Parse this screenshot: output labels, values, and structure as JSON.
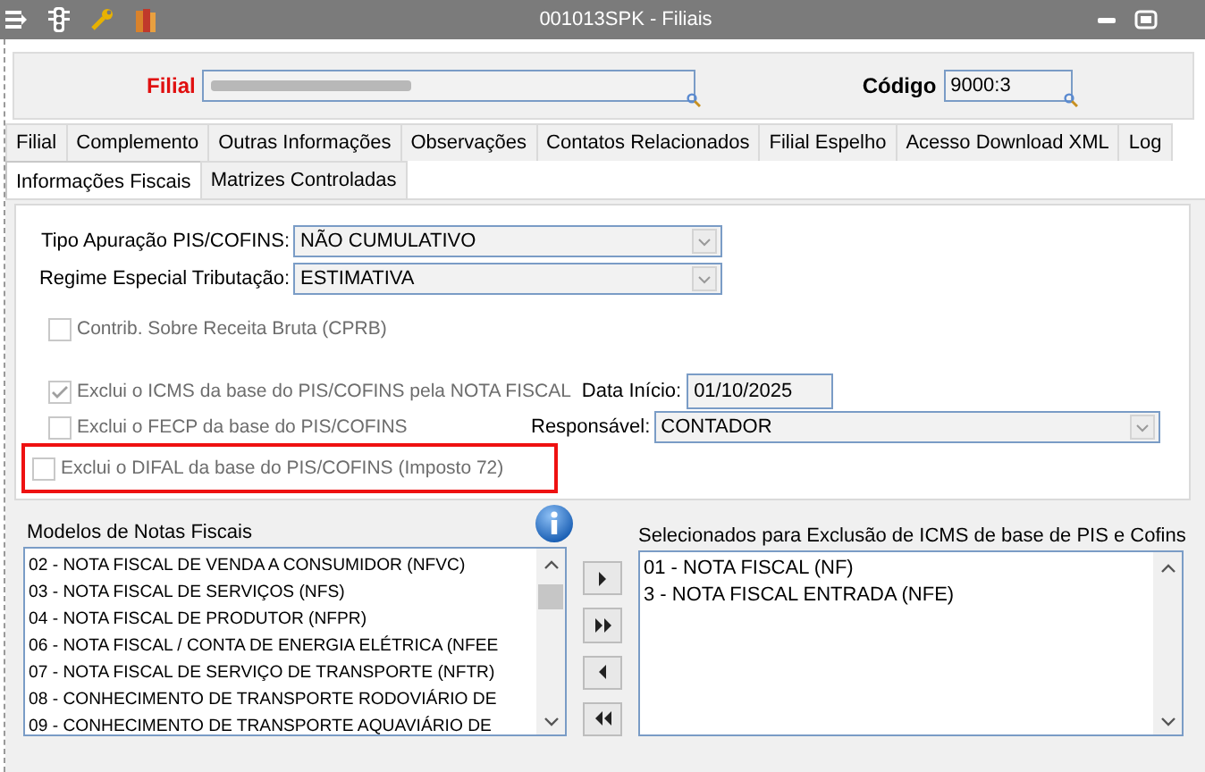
{
  "window": {
    "title": "001013SPK - Filiais"
  },
  "header": {
    "filial": {
      "label": "Filial",
      "redacted": true
    },
    "codigo": {
      "label": "Código",
      "value": "9000:3"
    }
  },
  "tabs_row1": [
    {
      "label": "Filial",
      "selected": false
    },
    {
      "label": "Complemento",
      "selected": false
    },
    {
      "label": "Outras Informações",
      "selected": false
    },
    {
      "label": "Observações",
      "selected": false
    },
    {
      "label": "Contatos Relacionados",
      "selected": false
    },
    {
      "label": "Filial Espelho",
      "selected": false
    },
    {
      "label": "Acesso Download XML",
      "selected": false
    },
    {
      "label": "Log",
      "selected": false
    }
  ],
  "tabs_row2": [
    {
      "label": "Informações Fiscais",
      "selected": true
    },
    {
      "label": "Matrizes Controladas",
      "selected": false
    }
  ],
  "combos": [
    {
      "label": "Tipo Apuração PIS/COFINS:",
      "value": "NÃO CUMULATIVO"
    },
    {
      "label": "Regime Especial Tributação:",
      "value": "ESTIMATIVA"
    }
  ],
  "checkboxes": [
    {
      "label": "Contrib. Sobre Receita Bruta (CPRB)",
      "checked": false,
      "highlighted": false
    },
    {
      "label": "Exclui o ICMS da base do PIS/COFINS pela NOTA FISCAL",
      "checked": true,
      "highlighted": false
    },
    {
      "label": "Exclui o FECP da base do PIS/COFINS",
      "checked": false,
      "highlighted": false
    },
    {
      "label": "Exclui o DIFAL da base do PIS/COFINS (Imposto 72)",
      "checked": false,
      "highlighted": true
    }
  ],
  "data_inicio": {
    "label": "Data Início:",
    "value": "01/10/2025"
  },
  "responsavel": {
    "label": "Responsável:",
    "value": "CONTADOR"
  },
  "modelos": {
    "label": "Modelos de Notas Fiscais",
    "items": [
      "02  - NOTA FISCAL DE VENDA A CONSUMIDOR (NFVC)",
      "03  - NOTA FISCAL DE SERVIÇOS (NFS)",
      "04  - NOTA FISCAL DE PRODUTOR (NFPR)",
      "06  - NOTA FISCAL / CONTA DE ENERGIA ELÉTRICA (NFEE",
      "07  - NOTA FISCAL DE SERVIÇO DE TRANSPORTE (NFTR)",
      "08  - CONHECIMENTO DE TRANSPORTE RODOVIÁRIO DE",
      "09  - CONHECIMENTO DE TRANSPORTE AQUAVIÁRIO DE"
    ]
  },
  "move_buttons": [
    {
      "kind": "one-right"
    },
    {
      "kind": "all-right"
    },
    {
      "kind": "one-left"
    },
    {
      "kind": "all-left"
    }
  ],
  "selecionados": {
    "label": "Selecionados para Exclusão de ICMS de base de PIS e Cofins",
    "items": [
      "01  - NOTA FISCAL (NF)",
      "3   - NOTA FISCAL ENTRADA (NFE)"
    ]
  }
}
